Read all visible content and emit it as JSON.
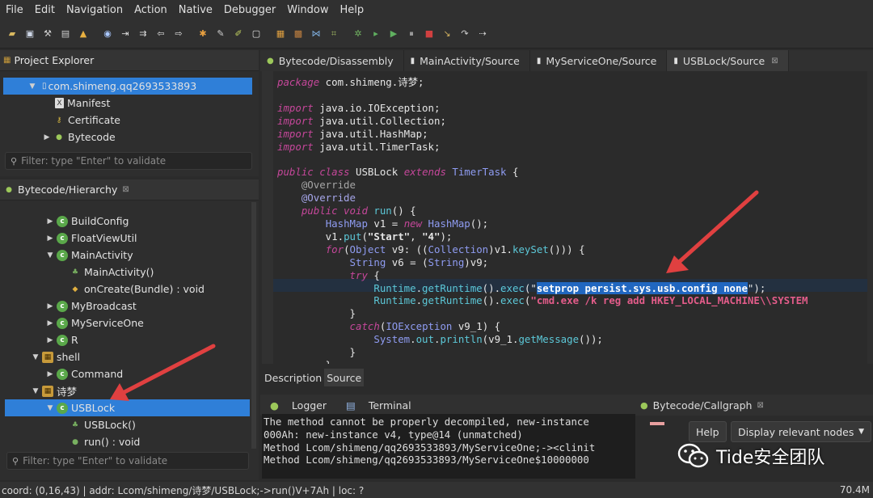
{
  "menu": [
    "File",
    "Edit",
    "Navigation",
    "Action",
    "Native",
    "Debugger",
    "Window",
    "Help"
  ],
  "toolbar_icons": [
    "open-icon",
    "save-icon",
    "wrench-icon",
    "tool-icon",
    "flame-icon",
    "globe-icon",
    "step-icon",
    "export-icon",
    "back-icon",
    "forward-icon",
    "gears-icon",
    "comment-icon",
    "pencil-icon",
    "doc-icon",
    "grid-icon",
    "grid2-icon",
    "graph-icon",
    "tree-icon",
    "bug-icon",
    "run-icon",
    "run2-icon",
    "pause-icon",
    "stop-icon",
    "step-into-icon",
    "step-over-icon",
    "step-out-icon"
  ],
  "project_explorer": {
    "title": "Project Explorer",
    "root": "com.shimeng.qq2693533893",
    "children": [
      "Manifest",
      "Certificate",
      "Bytecode"
    ],
    "filter_placeholder": "Filter: type \"Enter\" to validate"
  },
  "hierarchy": {
    "title": "Bytecode/Hierarchy",
    "rows": [
      {
        "label": "BuildConfig"
      },
      {
        "label": "FloatViewUtil"
      },
      {
        "label": "MainActivity"
      },
      {
        "label": "MainActivity()"
      },
      {
        "label": "onCreate(Bundle) : void"
      },
      {
        "label": "MyBroadcast"
      },
      {
        "label": "MyServiceOne"
      },
      {
        "label": "R"
      },
      {
        "label": "shell"
      },
      {
        "label": "Command"
      },
      {
        "label": "诗梦"
      },
      {
        "label": "USBLock"
      },
      {
        "label": "USBLock()"
      },
      {
        "label": "run() : void"
      }
    ],
    "filter_placeholder": "Filter: type \"Enter\" to validate"
  },
  "editor_tabs": [
    "Bytecode/Disassembly",
    "MainActivity/Source",
    "MyServiceOne/Source",
    "USBLock/Source"
  ],
  "code": {
    "package_kw": "package",
    "package_name": " com.shimeng.诗梦;",
    "imports": [
      "java.io.IOException",
      "java.util.Collection",
      "java.util.HashMap",
      "java.util.TimerTask"
    ],
    "class_name": "USBLock",
    "super_name": "TimerTask",
    "override": "@Override",
    "method": "run",
    "str_start": "\"Start\"",
    "str_4": "\"4\"",
    "cmd1": "setprop persist.sys.usb.config none",
    "cmd2": "\"cmd.exe /k reg add HKEY_LOCAL_MACHINE\\\\SYSTEM",
    "var_v1": "v1",
    "var_v9": "v9",
    "var_v6": "v6",
    "var_v9_1": "v9_1"
  },
  "desc_tabs": [
    "Description",
    "Source"
  ],
  "log_tabs": [
    "Logger",
    "Terminal"
  ],
  "log_lines": [
    "The method cannot be properly decompiled, new-instance",
    "000Ah: new-instance v4, type@14 (unmatched)",
    "Method Lcom/shimeng/qq2693533893/MyServiceOne;-><clinit",
    "Method Lcom/shimeng/qq2693533893/MyServiceOne$10000000"
  ],
  "callgraph": {
    "title": "Bytecode/Callgraph",
    "help": "Help",
    "dropdown": "Display relevant nodes"
  },
  "status": {
    "left": "coord: (0,16,43) | addr: Lcom/shimeng/诗梦/USBLock;->run()V+7Ah | loc: ?",
    "right": "70.4M"
  },
  "watermark": "Tide安全团队"
}
